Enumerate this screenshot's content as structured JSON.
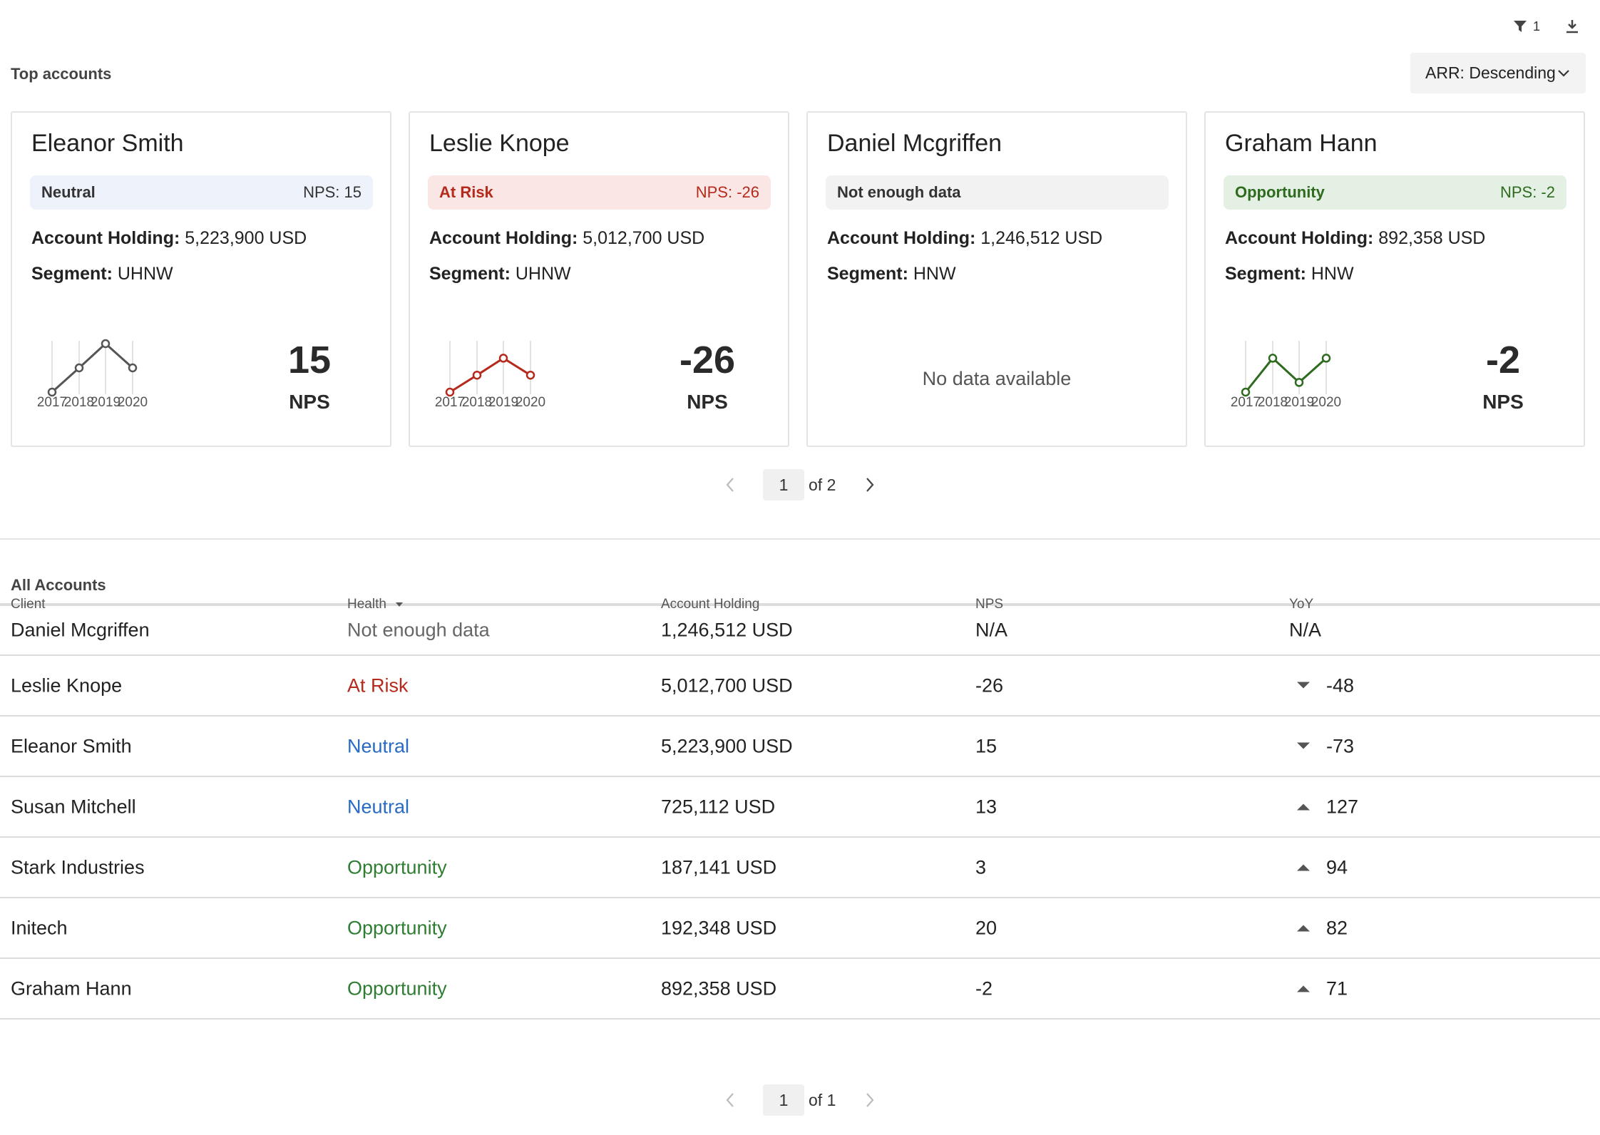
{
  "toolbar": {
    "filter_count": "1",
    "filter_icon": "filter-icon",
    "download_icon": "download-icon"
  },
  "top_accounts": {
    "title": "Top accounts",
    "sort_label": "ARR: Descending",
    "cards": [
      {
        "name": "Eleanor Smith",
        "status": "Neutral",
        "nps_badge": "NPS: 15",
        "holding_label": "Account Holding:",
        "holding": "5,223,900 USD",
        "segment_label": "Segment:",
        "segment": "UHNW",
        "nps": "15",
        "nps_label": "NPS",
        "colors": {
          "badge_bg": "#eef3fb",
          "text": "#333333",
          "line": "#555555"
        },
        "trend": {
          "years": [
            "2017",
            "2018",
            "2019",
            "2020"
          ],
          "values": [
            0,
            0.5,
            1,
            0.5
          ]
        }
      },
      {
        "name": "Leslie Knope",
        "status": "At Risk",
        "nps_badge": "NPS: -26",
        "holding_label": "Account Holding:",
        "holding": "5,012,700 USD",
        "segment_label": "Segment:",
        "segment": "UHNW",
        "nps": "-26",
        "nps_label": "NPS",
        "colors": {
          "badge_bg": "#fbe6e6",
          "text": "#b52a1c",
          "line": "#b52a1c"
        },
        "trend": {
          "years": [
            "2017",
            "2018",
            "2019",
            "2020"
          ],
          "values": [
            0,
            0.35,
            0.7,
            0.35
          ]
        }
      },
      {
        "name": "Daniel Mcgriffen",
        "status": "Not enough data",
        "nps_badge": "",
        "holding_label": "Account Holding:",
        "holding": "1,246,512 USD",
        "segment_label": "Segment:",
        "segment": "HNW",
        "no_data": "No data available",
        "colors": {
          "badge_bg": "#f2f2f2",
          "text": "#333333",
          "line": "#555555"
        }
      },
      {
        "name": "Graham Hann",
        "status": "Opportunity",
        "nps_badge": "NPS: -2",
        "holding_label": "Account Holding:",
        "holding": "892,358 USD",
        "segment_label": "Segment:",
        "segment": "HNW",
        "nps": "-2",
        "nps_label": "NPS",
        "colors": {
          "badge_bg": "#e4f0e4",
          "text": "#2e6b1f",
          "line": "#2e6b1f"
        },
        "trend": {
          "years": [
            "2017",
            "2018",
            "2019",
            "2020"
          ],
          "values": [
            0,
            0.7,
            0.2,
            0.7
          ]
        }
      }
    ],
    "pager": {
      "page": "1",
      "of_text": "of 2"
    }
  },
  "all_accounts": {
    "title": "All Accounts",
    "columns": [
      "Client",
      "Health",
      "Account Holding",
      "NPS",
      "YoY"
    ],
    "rows": [
      {
        "client": "Daniel Mcgriffen",
        "health": "Not enough data",
        "health_color": "#666666",
        "holding": "1,246,512 USD",
        "nps": "N/A",
        "yoy": "N/A",
        "trend": "none"
      },
      {
        "client": "Leslie Knope",
        "health": "At Risk",
        "health_color": "#b52a1c",
        "holding": "5,012,700 USD",
        "nps": "-26",
        "yoy": "-48",
        "trend": "down"
      },
      {
        "client": "Eleanor Smith",
        "health": "Neutral",
        "health_color": "#2a6bc2",
        "holding": "5,223,900 USD",
        "nps": "15",
        "yoy": "-73",
        "trend": "down"
      },
      {
        "client": "Susan Mitchell",
        "health": "Neutral",
        "health_color": "#2a6bc2",
        "holding": "725,112 USD",
        "nps": "13",
        "yoy": "127",
        "trend": "up"
      },
      {
        "client": "Stark Industries",
        "health": "Opportunity",
        "health_color": "#2e7d32",
        "holding": "187,141 USD",
        "nps": "3",
        "yoy": "94",
        "trend": "up"
      },
      {
        "client": "Initech",
        "health": "Opportunity",
        "health_color": "#2e7d32",
        "holding": "192,348 USD",
        "nps": "20",
        "yoy": "82",
        "trend": "up"
      },
      {
        "client": "Graham Hann",
        "health": "Opportunity",
        "health_color": "#2e7d32",
        "holding": "892,358 USD",
        "nps": "-2",
        "yoy": "71",
        "trend": "up"
      }
    ],
    "pager": {
      "page": "1",
      "of_text": "of 1"
    }
  }
}
